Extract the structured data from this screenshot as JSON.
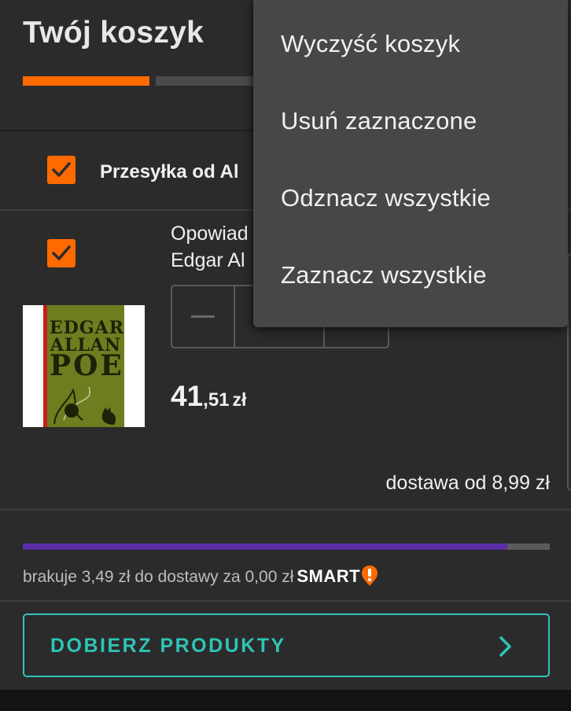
{
  "header": {
    "title": "Twój koszyk",
    "steps": [
      {
        "state": "active"
      },
      {
        "state": "inactive"
      }
    ]
  },
  "seller": {
    "label": "Przesyłka od Al",
    "checked": true
  },
  "item": {
    "checked": true,
    "title_line1": "Opowiad",
    "title_line2": "Edgar Al",
    "cover": {
      "line1": "EDGAR",
      "line2": "ALLAN",
      "line3": "POE"
    },
    "price_int": "41",
    "price_dec": ",51",
    "price_currency": "zł",
    "delivery": "dostawa od 8,99 zł"
  },
  "smart_progress": {
    "fill_percent": 92,
    "text": "brakuje 3,49 zł do dostawy za 0,00 zł",
    "brand": "SMART"
  },
  "cta": {
    "label": "DOBIERZ PRODUKTY"
  },
  "menu": {
    "items": [
      {
        "label": "Wyczyść koszyk"
      },
      {
        "label": "Usuń zaznaczone"
      },
      {
        "label": "Odznacz wszystkie"
      },
      {
        "label": "Zaznacz wszystkie"
      }
    ]
  },
  "colors": {
    "accent": "#ff6a00",
    "teal": "#2ec4b6",
    "progress": "#5a2ea6",
    "background": "#2b2b2b",
    "menu": "#474747"
  }
}
